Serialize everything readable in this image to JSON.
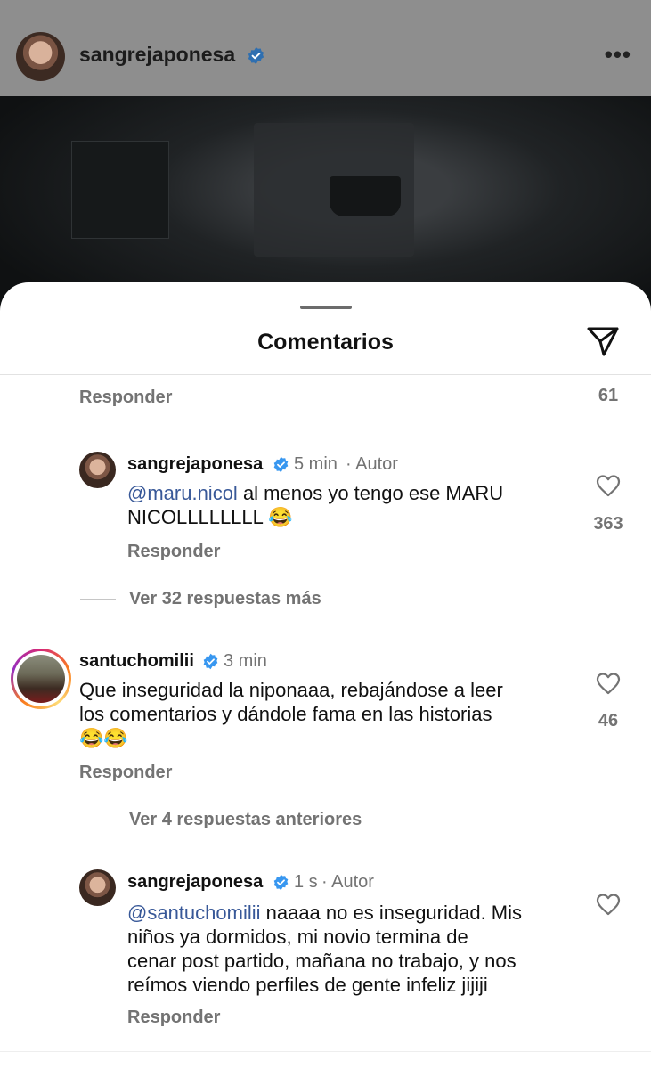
{
  "post": {
    "top_caption": "sangrejaponesa",
    "username": "sangrejaponesa",
    "more": "•••"
  },
  "sheet": {
    "title": "Comentarios"
  },
  "comments": {
    "prev": {
      "reply": "Responder",
      "likes": "61"
    },
    "c1": {
      "username": "sangrejaponesa",
      "time": "5 min",
      "author": "· Autor",
      "mention": "@maru.nicol",
      "text_line1": " al menos yo tengo ese MARU",
      "text_line2": "NICOLLLLLLLL 😂",
      "reply": "Responder",
      "likes": "363"
    },
    "more1": "Ver 32 respuestas más",
    "c2": {
      "username": "santuchomilii",
      "time": "3 min",
      "text_line1": "Que inseguridad la niponaaa, rebajándose a leer",
      "text_line2": "los comentarios y dándole fama en las historias",
      "text_line3": "😂😂",
      "reply": "Responder",
      "likes": "46"
    },
    "more2": "Ver 4 respuestas anteriores",
    "c3": {
      "username": "sangrejaponesa",
      "time": "1 s",
      "author": "· Autor",
      "mention": "@santuchomilii",
      "text_line1": " naaaa no es inseguridad. Mis",
      "text_line2": "niños ya dormidos, mi novio termina de",
      "text_line3": "cenar post partido, mañana no trabajo, y nos",
      "text_line4": "reímos viendo perfiles de gente infeliz jijiji",
      "reply": "Responder"
    }
  },
  "colors": {
    "verified": "#3897f0",
    "mention": "#385898",
    "secondary": "#737373"
  },
  "icons": {
    "share": "paper-plane-icon",
    "like": "heart-icon",
    "verified": "verified-badge-icon"
  }
}
